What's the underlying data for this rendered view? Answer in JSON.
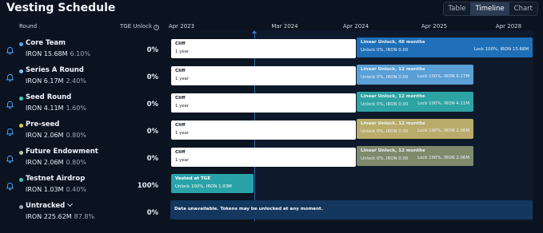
{
  "header": {
    "title": "Vesting Schedule"
  },
  "view_toggle": {
    "options": [
      "Table",
      "Timeline",
      "Chart"
    ],
    "selected": "Timeline"
  },
  "columns": {
    "round": "Round",
    "tge_unlock": "TGE Unlock",
    "info_icon": "i"
  },
  "timeline": {
    "dates": [
      "Apr 2023",
      "Mar 2024",
      "Apr 2024",
      "Apr 2025",
      "Apr 2028"
    ]
  },
  "colors": {
    "dot_core": "#4aa8ff",
    "dot_series_a": "#7ec3ff",
    "dot_seed": "#3ed0c2",
    "dot_preseed": "#e8c650",
    "dot_future": "#b9c6a4",
    "dot_testnet": "#39c9c1",
    "dot_untracked": "#9aa6b8",
    "bar_core": "#1f6fb8",
    "bar_series_a": "#5a9fd6",
    "bar_seed": "#2ea3a3",
    "bar_preseed": "#b9ac6a",
    "bar_future": "#7f8a6c",
    "bar_testnet": "#2aa3a8",
    "bar_untracked": "#13375f"
  },
  "rows": [
    {
      "name": "Core Team",
      "amount": "IRON 15.68M",
      "percent": "6.10%",
      "tge": "0%",
      "cliff": {
        "title": "Cliff",
        "duration": "1 year"
      },
      "unlock": {
        "title": "Linear Unlock, 48 months",
        "detail": "Unlock 0%, IRON 0.00",
        "lock": "Lock 100%, IRON 15.68M"
      }
    },
    {
      "name": "Series A Round",
      "amount": "IRON 6.17M",
      "percent": "2.40%",
      "tge": "0%",
      "cliff": {
        "title": "Cliff",
        "duration": "1 year"
      },
      "unlock": {
        "title": "Linear Unlock, 12 months",
        "detail": "Unlock 0%, IRON 0.00",
        "lock": "Lock 100%, IRON 6.17M"
      }
    },
    {
      "name": "Seed Round",
      "amount": "IRON 4.11M",
      "percent": "1.60%",
      "tge": "0%",
      "cliff": {
        "title": "Cliff",
        "duration": "1 year"
      },
      "unlock": {
        "title": "Linear Unlock, 12 months",
        "detail": "Unlock 0%, IRON 0.00",
        "lock": "Lock 100%, IRON 4.11M"
      }
    },
    {
      "name": "Pre-seed",
      "amount": "IRON 2.06M",
      "percent": "0.80%",
      "tge": "0%",
      "cliff": {
        "title": "Cliff",
        "duration": "1 year"
      },
      "unlock": {
        "title": "Linear Unlock, 12 months",
        "detail": "Unlock 0%, IRON 0.00",
        "lock": "Lock 100%, IRON 2.06M"
      }
    },
    {
      "name": "Future Endowment",
      "amount": "IRON 2.06M",
      "percent": "0.80%",
      "tge": "0%",
      "cliff": {
        "title": "Cliff",
        "duration": "1 year"
      },
      "unlock": {
        "title": "Linear Unlock, 12 months",
        "detail": "Unlock 0%, IRON 0.00",
        "lock": "Lock 100%, IRON 2.06M"
      }
    },
    {
      "name": "Testnet Airdrop",
      "amount": "IRON 1.03M",
      "percent": "0.40%",
      "tge": "100%",
      "tge_bar": {
        "title": "Vested at TGE",
        "detail": "Unlock 100%, IRON 1.03M"
      }
    },
    {
      "name": "Untracked",
      "amount": "IRON 225.62M",
      "percent": "87.8%",
      "tge": "0%",
      "note": "Data unavailable. Tokens may be unlocked at any moment."
    }
  ]
}
